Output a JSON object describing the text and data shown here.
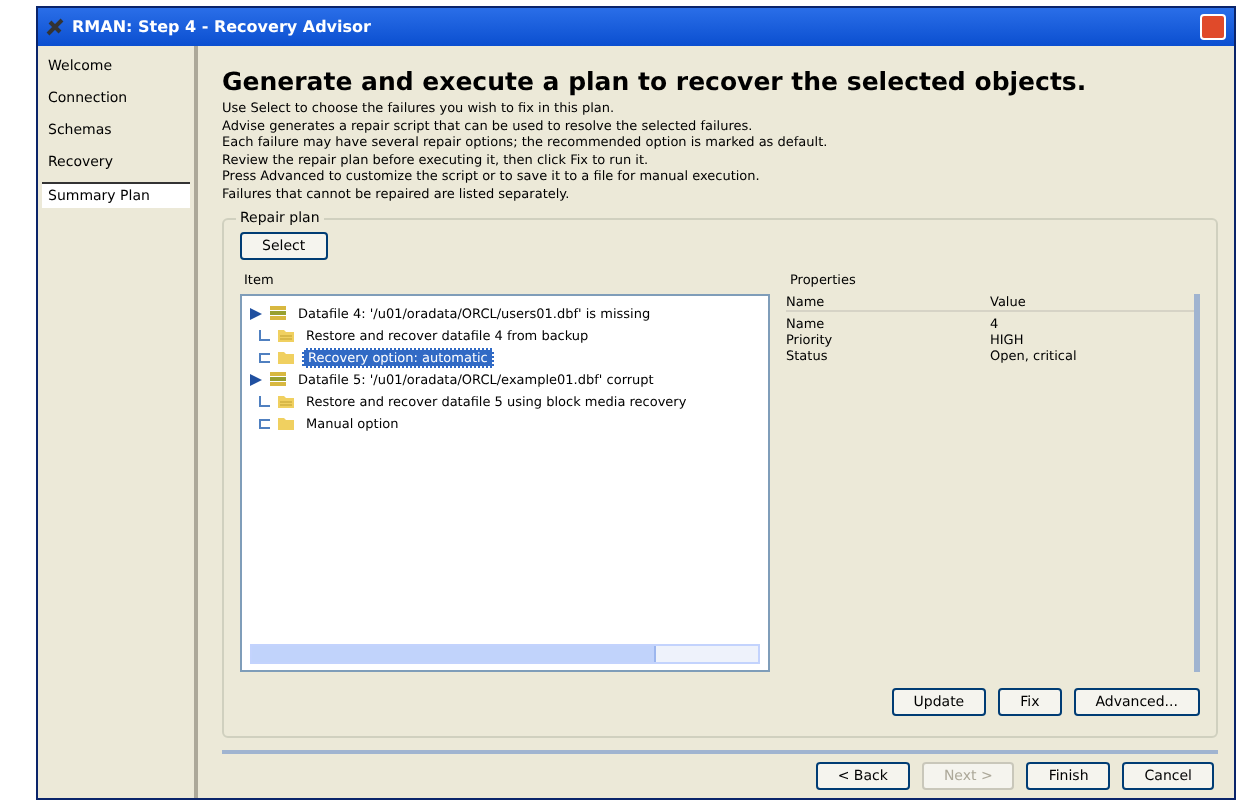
{
  "window": {
    "title": "RMAN: Step 4 - Recovery Advisor"
  },
  "sidebar": {
    "items": [
      {
        "label": "Welcome",
        "selected": false
      },
      {
        "label": "Connection",
        "selected": false
      },
      {
        "label": "Schemas",
        "selected": false
      },
      {
        "label": "Recovery",
        "selected": false
      },
      {
        "label": "Summary Plan",
        "selected": true
      }
    ]
  },
  "heading": "Generate and execute a plan to recover the selected objects.",
  "description": [
    "Use Select to choose the failures you wish to fix in this plan.",
    "Advise generates a repair script that can be used to resolve the selected failures.",
    "Each failure may have several repair options; the recommended option is marked as default.",
    "Review the repair plan before executing it, then click Fix to run it.",
    "Press Advanced to customize the script or to save it to a file for manual execution.",
    "Failures that cannot be repaired are listed separately."
  ],
  "plan": {
    "label": "Repair plan",
    "select_button": "Select",
    "tree": {
      "column": "Item",
      "rows": [
        {
          "label": "Datafile 4: '/u01/oradata/ORCL/users01.dbf' is missing",
          "kind": "failure",
          "selected": false,
          "children": [
            {
              "label": "Restore and recover datafile 4 from backup",
              "kind": "step",
              "selected": false
            },
            {
              "label": "Recovery option: automatic",
              "kind": "folder",
              "selected": true
            }
          ]
        },
        {
          "label": "Datafile 5: '/u01/oradata/ORCL/example01.dbf' corrupt",
          "kind": "failure",
          "selected": false,
          "children": [
            {
              "label": "Restore and recover datafile 5 using block media recovery",
              "kind": "step",
              "selected": false
            },
            {
              "label": "Manual option",
              "kind": "folder",
              "selected": false
            }
          ]
        }
      ]
    }
  },
  "properties": {
    "title": "Properties",
    "columns": [
      "Name",
      "Value"
    ],
    "rows": [
      [
        "Name",
        "4"
      ],
      [
        "Priority",
        "HIGH"
      ],
      [
        "Status",
        "Open, critical"
      ]
    ]
  },
  "plan_buttons": [
    {
      "label": "Update",
      "disabled": false
    },
    {
      "label": "Fix",
      "disabled": false
    },
    {
      "label": "Advanced...",
      "disabled": false
    }
  ],
  "footer_buttons": [
    {
      "label": "< Back",
      "disabled": false
    },
    {
      "label": "Next >",
      "disabled": true
    },
    {
      "label": "Finish",
      "disabled": false
    },
    {
      "label": "Cancel",
      "disabled": false
    }
  ]
}
